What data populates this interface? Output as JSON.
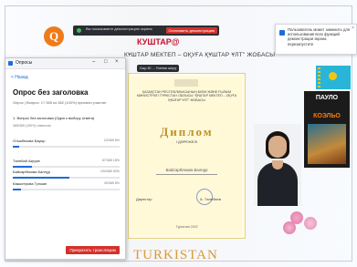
{
  "screen_share": {
    "status_text": "Вы показываете демонстрацию экрана",
    "stop_label": "Остановить демонстрацию"
  },
  "header": {
    "brand": "КУШТАР@",
    "subtitle": "КҰШТАР МЕКТЕП – ОҚУҒА ҚҰШТАР ҰЛТ\" ЖОБАСЫ"
  },
  "meet_tag": "Сыр-Ю ... Ученик шеру",
  "diploma": {
    "intro": "ҚАЗАҚСТАН РЕСПУБЛИКАСЫНЫҢ БІЛІМ ЖӘНЕ ҒЫЛЫМ МИНИСТРЛІГІ ТҮРКІСТАН ОБЛЫСЫ \"ҚҰШТАР МЕКТЕП – ОҚУҒА ҚҰШТАР ҰЛТ\" ЖОБАСЫ",
    "title": "Диплом",
    "subtitle": "І ДӘРЕЖЕЛІ",
    "recipient": "Байсарбекова Балнұр",
    "director_label": "Директор",
    "signer": "А. Төлебаев",
    "date": "Түркістан 2022"
  },
  "turkistan_label": "TURKISTAN",
  "book": {
    "title": "ПАУЛО",
    "author": "КОЭЛЬО"
  },
  "notification": {
    "text": "Пользователь может заменить для использования всех функций демонстрации экрана перезапустите"
  },
  "poll_window": {
    "window_title": "Опросы",
    "back_label": "< Назад",
    "poll_title": "Опрос без заголовка",
    "poll_meta": "Опрос  |  Вопрос: 1?  365 из 382 (100%)  приняли участие",
    "question": "1. Вопрос без заголовка (Один к выбору ответа)",
    "question_meta": "365/365 (100%) ответили",
    "options": [
      {
        "label": "Отыкбекова Бауыр",
        "value": "23/365  6%",
        "fraction": 0.06
      },
      {
        "label": "Төлебай Ақерке",
        "value": "67/365  18%",
        "fraction": 0.18
      },
      {
        "label": "Байсарбекова Балнұр",
        "value": "194/365  53%",
        "fraction": 0.53
      },
      {
        "label": "Кажыгерова Гүлжан",
        "value": "29/365  8%",
        "fraction": 0.08
      }
    ],
    "stop_button": "Прекратить трансляцию"
  },
  "colors": {
    "accent": "#1e6cd8",
    "stop": "#d4302a",
    "diploma_gold": "#c0902a"
  }
}
